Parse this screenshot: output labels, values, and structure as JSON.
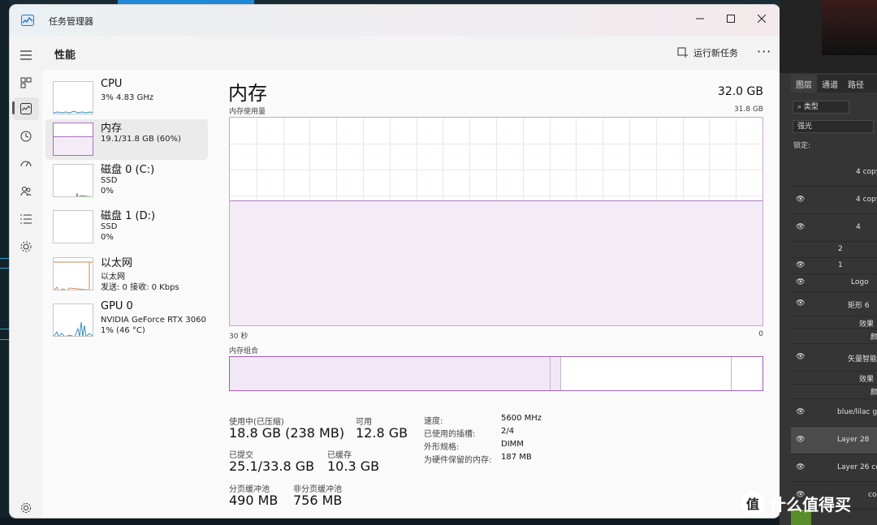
{
  "window": {
    "title": "任务管理器"
  },
  "header": {
    "title": "性能",
    "run_task_label": "运行新任务",
    "more_label": "···"
  },
  "sidebar": {
    "icons": [
      "hamburger-icon",
      "processes-icon",
      "performance-icon",
      "app-history-icon",
      "startup-icon",
      "users-icon",
      "details-icon",
      "services-icon",
      "settings-icon"
    ]
  },
  "perf_list": [
    {
      "name": "CPU",
      "sub1": "3% 4.83 GHz",
      "sub2": ""
    },
    {
      "name": "内存",
      "sub1": "19.1/31.8 GB (60%)",
      "sub2": ""
    },
    {
      "name": "磁盘 0 (C:)",
      "sub1": "SSD",
      "sub2": "0%"
    },
    {
      "name": "磁盘 1 (D:)",
      "sub1": "SSD",
      "sub2": "0%"
    },
    {
      "name": "以太网",
      "sub1": "以太网",
      "sub2": "发送: 0 接收: 0 Kbps"
    },
    {
      "name": "GPU 0",
      "sub1": "NVIDIA GeForce RTX 3060",
      "sub2": "1% (46 °C)"
    }
  ],
  "memory": {
    "title": "内存",
    "total": "32.0 GB",
    "usage_label": "内存使用量",
    "usage_max": "31.8 GB",
    "usage_fraction": 0.6,
    "axis_left": "30 秒",
    "axis_right": "0",
    "composition_label": "内存组合",
    "composition": {
      "in_use": 0.6,
      "modified": 0.02,
      "standby": 0.32,
      "free": 0.06
    },
    "stats": {
      "in_use_label": "使用中(已压缩)",
      "in_use_value": "18.8 GB (238 MB)",
      "available_label": "可用",
      "available_value": "12.8 GB",
      "committed_label": "已提交",
      "committed_value": "25.1/33.8 GB",
      "cached_label": "已缓存",
      "cached_value": "10.3 GB",
      "paged_label": "分页缓冲池",
      "paged_value": "490 MB",
      "nonpaged_label": "非分页缓冲池",
      "nonpaged_value": "756 MB"
    },
    "details": [
      {
        "key": "速度:",
        "value": "5600 MHz"
      },
      {
        "key": "已使用的插槽:",
        "value": "2/4"
      },
      {
        "key": "外形规格:",
        "value": "DIMM"
      },
      {
        "key": "为硬件保留的内存:",
        "value": "187 MB"
      }
    ]
  },
  "photoshop": {
    "tabs": [
      "图层",
      "通道",
      "路径"
    ],
    "filter_kind": "类型",
    "blend_mode": "强光",
    "lock_label": "锁定:",
    "layers": [
      {
        "name": "4 copy"
      },
      {
        "name": "4 copy"
      },
      {
        "name": "4"
      },
      {
        "name": "2"
      },
      {
        "name": "1"
      },
      {
        "name": "Logo"
      },
      {
        "name": "矩形 6"
      },
      {
        "name": "效果"
      },
      {
        "name": "颜"
      },
      {
        "name": "矢量智能"
      },
      {
        "name": "效果"
      },
      {
        "name": "颜"
      },
      {
        "name": "blue/lilac gra"
      },
      {
        "name": "Layer 28"
      },
      {
        "name": "Layer 26 cop"
      },
      {
        "name": "cop"
      }
    ]
  },
  "watermark": {
    "text": "什么值得买",
    "badge": "值"
  }
}
